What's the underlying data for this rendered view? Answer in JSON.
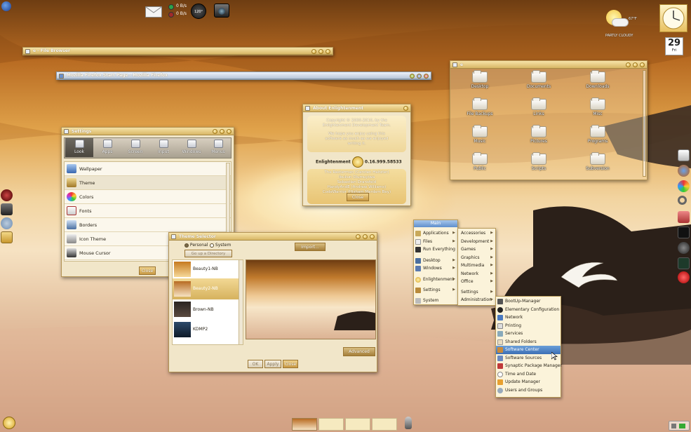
{
  "top_bar": {
    "net_down": "0 B/s",
    "net_up": "0 B/s",
    "temperature_gauge": "120°",
    "icons": [
      "firefox-icon",
      "mail-icon",
      "camera-icon"
    ]
  },
  "weather": {
    "temp": "67°F",
    "condition": "PARTLY CLOUDY"
  },
  "calendar": {
    "day": "29",
    "weekday": "Fri"
  },
  "file_browser": {
    "title": "e - File Browser"
  },
  "firefox_window": {
    "title": "Mozilla Firefox Start Page - Mozilla Firefox"
  },
  "home_window": {
    "title": "e",
    "folders": [
      "Desktop",
      "Documents",
      "Downloads",
      "File Backups",
      "Links",
      "Misc",
      "Music",
      "Pictures",
      "Programs",
      "Public",
      "Scripts",
      "Subversion"
    ]
  },
  "about": {
    "title": "About Enlightenment",
    "copyright": [
      "Copyright © 2000-2010, by the",
      "Enlightenment Development Team.",
      "",
      "We hope you enjoy using this",
      "software as much as we enjoyed",
      "writing it."
    ],
    "version_label": "Enlightenment",
    "version": "0.16.999.58533",
    "credits": [
      "The Rasterman (Carsten Haitzler)",
      "Ibukun Olumuyiwa",
      "Sebastian Dransfeld",
      "HandyAndE (Andrew Williams)",
      "CodeWarrior (Hisham Mardam Bey)"
    ],
    "close_label": "Close"
  },
  "settings": {
    "title": "Settings",
    "tabs": [
      "Look",
      "Apps",
      "Screen",
      "Input",
      "Windows",
      "Menus"
    ],
    "items": [
      "Wallpaper",
      "Theme",
      "Colors",
      "Fonts",
      "Borders",
      "Icon Theme",
      "Mouse Cursor"
    ],
    "close_label": "Close"
  },
  "theme_selector": {
    "title": "Theme Selector",
    "radio_personal": "Personal",
    "radio_system": "System",
    "up_dir": "Go up a Directory",
    "import_label": "Import...",
    "themes": [
      "Beauty1-NB",
      "Beauty2-NB",
      "Brown-NB",
      "KDMP2"
    ],
    "selected_theme": "Beauty2-NB",
    "advanced_label": "Advanced",
    "ok_label": "OK",
    "apply_label": "Apply",
    "close_label": "Close"
  },
  "main_menu": {
    "header": "Main",
    "items": [
      "Applications",
      "Files",
      "Run Everything",
      "Desktop",
      "Windows",
      "Enlightenment",
      "Settings",
      "System"
    ]
  },
  "apps_menu": {
    "items": [
      "Accessories",
      "Development",
      "Games",
      "Graphics",
      "Multimedia",
      "Network",
      "Office",
      "Settings",
      "Administration"
    ]
  },
  "admin_menu": {
    "items": [
      "BootUp-Manager",
      "Elementary Configuration",
      "Network",
      "Printing",
      "Services",
      "Shared Folders",
      "Software Center",
      "Software Sources",
      "Synaptic Package Manager",
      "Time and Date",
      "Update Manager",
      "Users and Groups"
    ],
    "highlighted": "Software Center"
  },
  "colors": {
    "accent": "#d8b766",
    "menu_highlight": "#3d6fb4",
    "window_bg": "#f1e6c9"
  }
}
